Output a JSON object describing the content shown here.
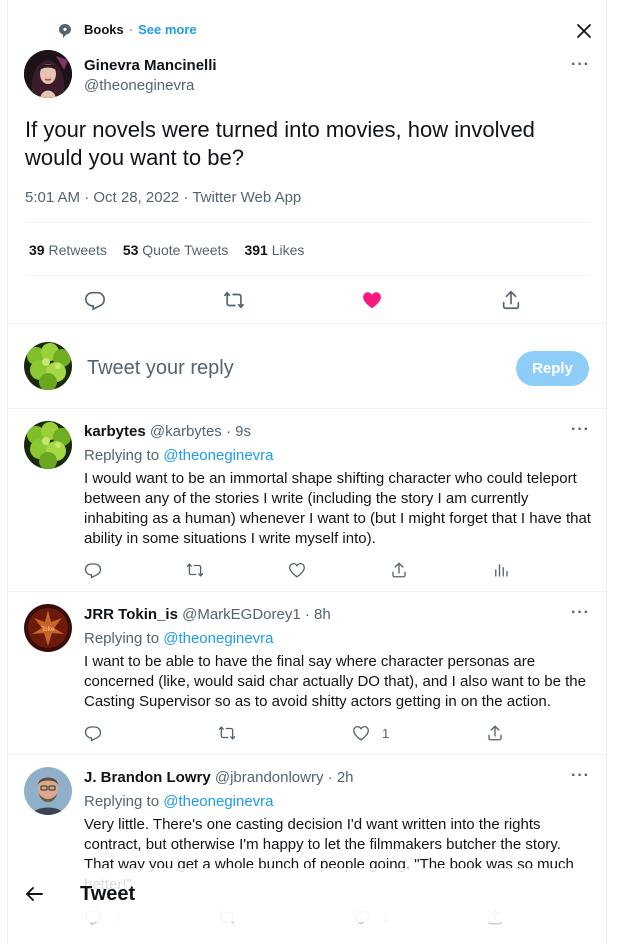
{
  "header": {
    "topic_icon": "topic-bubble-icon",
    "topic": "Books",
    "separator": "·",
    "see_more": "See more",
    "close_icon": "close-icon"
  },
  "author": {
    "name": "Ginevra Mancinelli",
    "handle": "@theoneginevra",
    "more": "···"
  },
  "tweet": {
    "text": "If your novels were turned into movies, how involved would you want to be?",
    "meta": "5:01 AM · Oct 28, 2022 · Twitter Web App"
  },
  "stats": {
    "retweets_count": "39",
    "retweets_label": "Retweets",
    "quotes_count": "53",
    "quotes_label": "Quote Tweets",
    "likes_count": "391",
    "likes_label": "Likes"
  },
  "reply_composer": {
    "placeholder": "Tweet your reply",
    "button": "Reply"
  },
  "replies": [
    {
      "name": "karbytes",
      "handle": "@karbytes",
      "time": "· 9s",
      "replying_label": "Replying to",
      "replying_to": "@theoneginevra",
      "text": "I would want to be an immortal shape shifting character who could teleport between any of the stories I write (including the story I am currently inhabiting as a human) whenever I want to (but I might forget that I have that ability in some situations I write myself into).",
      "like_count": "",
      "reply_count": ""
    },
    {
      "name": "JRR Tokin_is",
      "handle": "@MarkEGDorey1",
      "time": "· 8h",
      "replying_label": "Replying to",
      "replying_to": "@theoneginevra",
      "text": "I want to be able to have the final say where character personas are concerned (like, would said char actually DO that), and I also want to be the Casting Supervisor so as to avoid shitty actors getting in on the action.",
      "like_count": "1",
      "reply_count": ""
    },
    {
      "name": "J. Brandon Lowry",
      "handle": "@jbrandonlowry",
      "time": "· 2h",
      "replying_label": "Replying to",
      "replying_to": "@theoneginevra",
      "text": "Very little. There's one casting decision I'd want written into the rights contract, but otherwise I'm happy to let the filmmakers butcher the story. That way you get a whole bunch of people going, \"The book was so much better!\"",
      "like_count": "1",
      "reply_count": "1"
    }
  ],
  "bottom_bar": {
    "title": "Tweet"
  },
  "colors": {
    "accent": "#1d9bf0",
    "like": "#f91880",
    "muted": "#536471"
  }
}
